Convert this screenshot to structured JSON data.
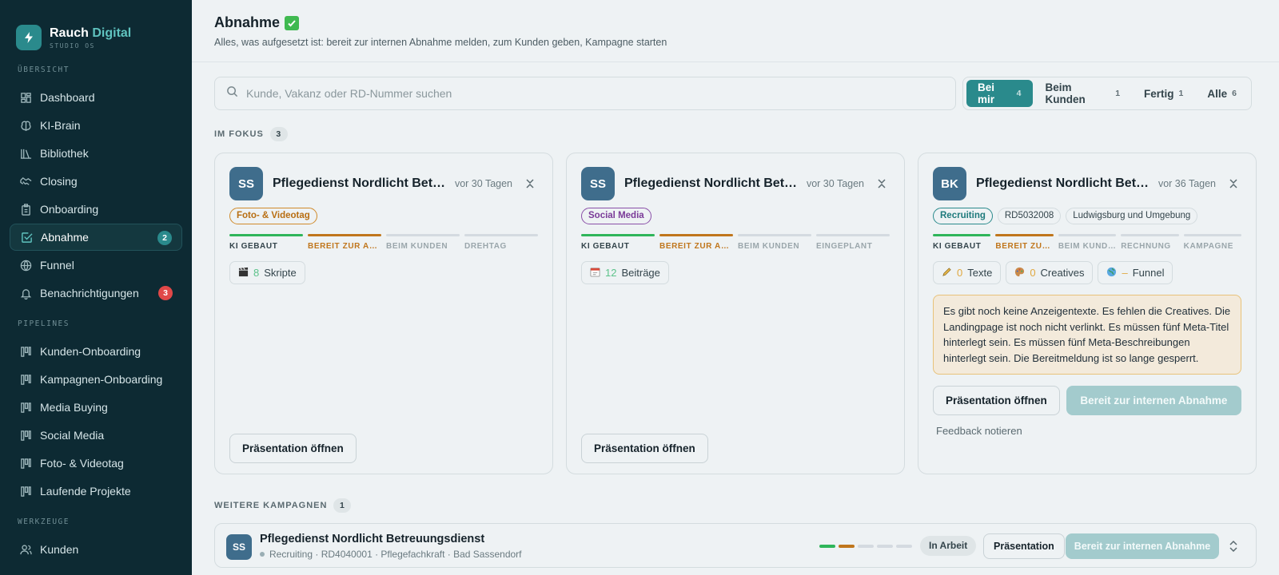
{
  "brand": {
    "name": "Rauch",
    "name_accent": "Digital",
    "sub": "STUDIO OS"
  },
  "sidebar": {
    "sections": [
      {
        "label": "ÜBERSICHT"
      },
      {
        "label": "PIPELINES"
      },
      {
        "label": "WERKZEUGE"
      }
    ],
    "items": [
      {
        "label": "Dashboard",
        "icon": "grid-icon"
      },
      {
        "label": "KI-Brain",
        "icon": "brain-icon"
      },
      {
        "label": "Bibliothek",
        "icon": "books-icon"
      },
      {
        "label": "Closing",
        "icon": "handshake-icon"
      },
      {
        "label": "Onboarding",
        "icon": "clipboard-icon"
      },
      {
        "label": "Abnahme",
        "icon": "check-square-icon",
        "badge": "2",
        "active": true
      },
      {
        "label": "Funnel",
        "icon": "globe-icon"
      },
      {
        "label": "Benachrichtigungen",
        "icon": "bell-icon",
        "badge": "3"
      },
      {
        "label": "Kunden-Onboarding",
        "icon": "kanban-icon"
      },
      {
        "label": "Kampagnen-Onboarding",
        "icon": "kanban-icon"
      },
      {
        "label": "Media Buying",
        "icon": "kanban-icon"
      },
      {
        "label": "Social Media",
        "icon": "kanban-icon"
      },
      {
        "label": "Foto- & Videotag",
        "icon": "kanban-icon"
      },
      {
        "label": "Laufende Projekte",
        "icon": "kanban-icon"
      },
      {
        "label": "Kunden",
        "icon": "users-icon"
      }
    ]
  },
  "header": {
    "title": "Abnahme",
    "subtitle": "Alles, was aufgesetzt ist: bereit zur internen Abnahme melden, zum Kunden geben, Kampagne starten"
  },
  "search": {
    "placeholder": "Kunde, Vakanz oder RD-Nummer suchen",
    "value": ""
  },
  "filters": [
    {
      "label": "Bei mir",
      "count": "4",
      "active": true
    },
    {
      "label": "Beim Kunden",
      "count": "1"
    },
    {
      "label": "Fertig",
      "count": "1"
    },
    {
      "label": "Alle",
      "count": "6"
    }
  ],
  "focus": {
    "title": "IM FOKUS",
    "count": "3",
    "cards": [
      {
        "initials": "SS",
        "title": "Pflegedienst Nordlicht Betreuungsdienst",
        "time": "vor 30 Tagen",
        "tags": [
          "Foto- & Videotag"
        ],
        "stages": [
          "KI GEBAUT",
          "BEREIT ZUR ABNAHME",
          "BEIM KUNDEN",
          "DREHTAG"
        ],
        "chips": [
          {
            "icon": "clapper-icon",
            "num": "8",
            "label": "Skripte"
          }
        ],
        "button": "Präsentation öffnen"
      },
      {
        "initials": "SS",
        "title": "Pflegedienst Nordlicht Betreuungsdienst",
        "time": "vor 30 Tagen",
        "tags": [
          "Social Media"
        ],
        "stages": [
          "KI GEBAUT",
          "BEREIT ZUR ABNAHME",
          "BEIM KUNDEN",
          "EINGEPLANT"
        ],
        "chips": [
          {
            "icon": "calendar-icon",
            "num": "12",
            "label": "Beiträge"
          }
        ],
        "button": "Präsentation öffnen"
      },
      {
        "initials": "BK",
        "title": "Pflegedienst Nordlicht Betreuungsdienst",
        "time": "vor 36 Tagen",
        "tags": [
          "Recruiting",
          "RD5032008",
          "Ludwigsburg und Umgebung"
        ],
        "stages": [
          "KI GEBAUT",
          "BEREIT ZUR ABNAHME",
          "BEIM KUNDEN",
          "RECHNUNG",
          "KAMPAGNE"
        ],
        "chips": [
          {
            "icon": "pencil-icon",
            "num": "0",
            "label": "Texte"
          },
          {
            "icon": "palette-icon",
            "num": "0",
            "label": "Creatives"
          },
          {
            "icon": "globe-icon",
            "num": "–",
            "label": "Funnel"
          }
        ],
        "warning": "Es gibt noch keine Anzeigentexte. Es fehlen die Creatives. Die Landingpage ist noch nicht verlinkt. Es müssen fünf Meta-Titel hinterlegt sein. Es müssen fünf Meta-Beschreibungen hinterlegt sein. Die Bereitmeldung ist so lange gesperrt.",
        "button": "Präsentation öffnen",
        "button_primary": "Bereit zur internen Abnahme",
        "feedback": "Feedback notieren"
      }
    ]
  },
  "more": {
    "title": "WEITERE KAMPAGNEN",
    "count": "1",
    "rows": [
      {
        "initials": "SS",
        "title": "Pflegedienst Nordlicht Betreuungsdienst",
        "meta": "Recruiting · RD4040001 · Pflegefachkraft · Bad Sassendorf",
        "status": "In Arbeit",
        "btn1": "Präsentation",
        "btn2": "Bereit zur internen Abnahme"
      }
    ]
  },
  "colors": {
    "sidebar_bg": "#0d2a33",
    "accent": "#2a8a8c",
    "ready_stage": "#c0761c",
    "done_stage": "#2fb55a",
    "alert_badge": "#e04848"
  }
}
